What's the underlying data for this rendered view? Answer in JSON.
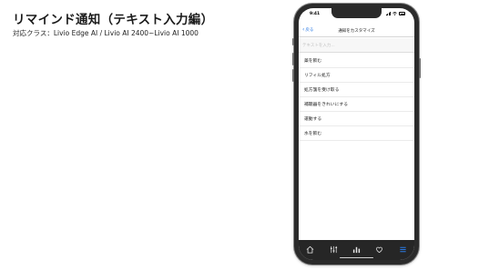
{
  "slide": {
    "title": "リマインド通知（テキスト入力編）",
    "subtitle": "対応クラス：Livio Edge AI / Livio AI 2400~Livio AI 1000"
  },
  "phone": {
    "status_time": "9:41",
    "nav": {
      "back_label": "戻る",
      "title": "通知をカスタマイズ"
    },
    "input": {
      "placeholder": "テキストを入力...",
      "value": ""
    },
    "phrases": [
      "薬を飲む",
      "リフィル処方",
      "処方箋を受け取る",
      "補聴器をきれいにする",
      "運動する",
      "水を飲む"
    ],
    "tabs": [
      {
        "icon": "home-icon"
      },
      {
        "icon": "equalizer-icon"
      },
      {
        "icon": "stats-icon"
      },
      {
        "icon": "wellness-icon"
      },
      {
        "icon": "menu-icon",
        "active": true
      }
    ],
    "colors": {
      "accent": "#2a7ae4",
      "tab_bar": "#262626",
      "tab_icon": "#e8e8e8"
    }
  }
}
